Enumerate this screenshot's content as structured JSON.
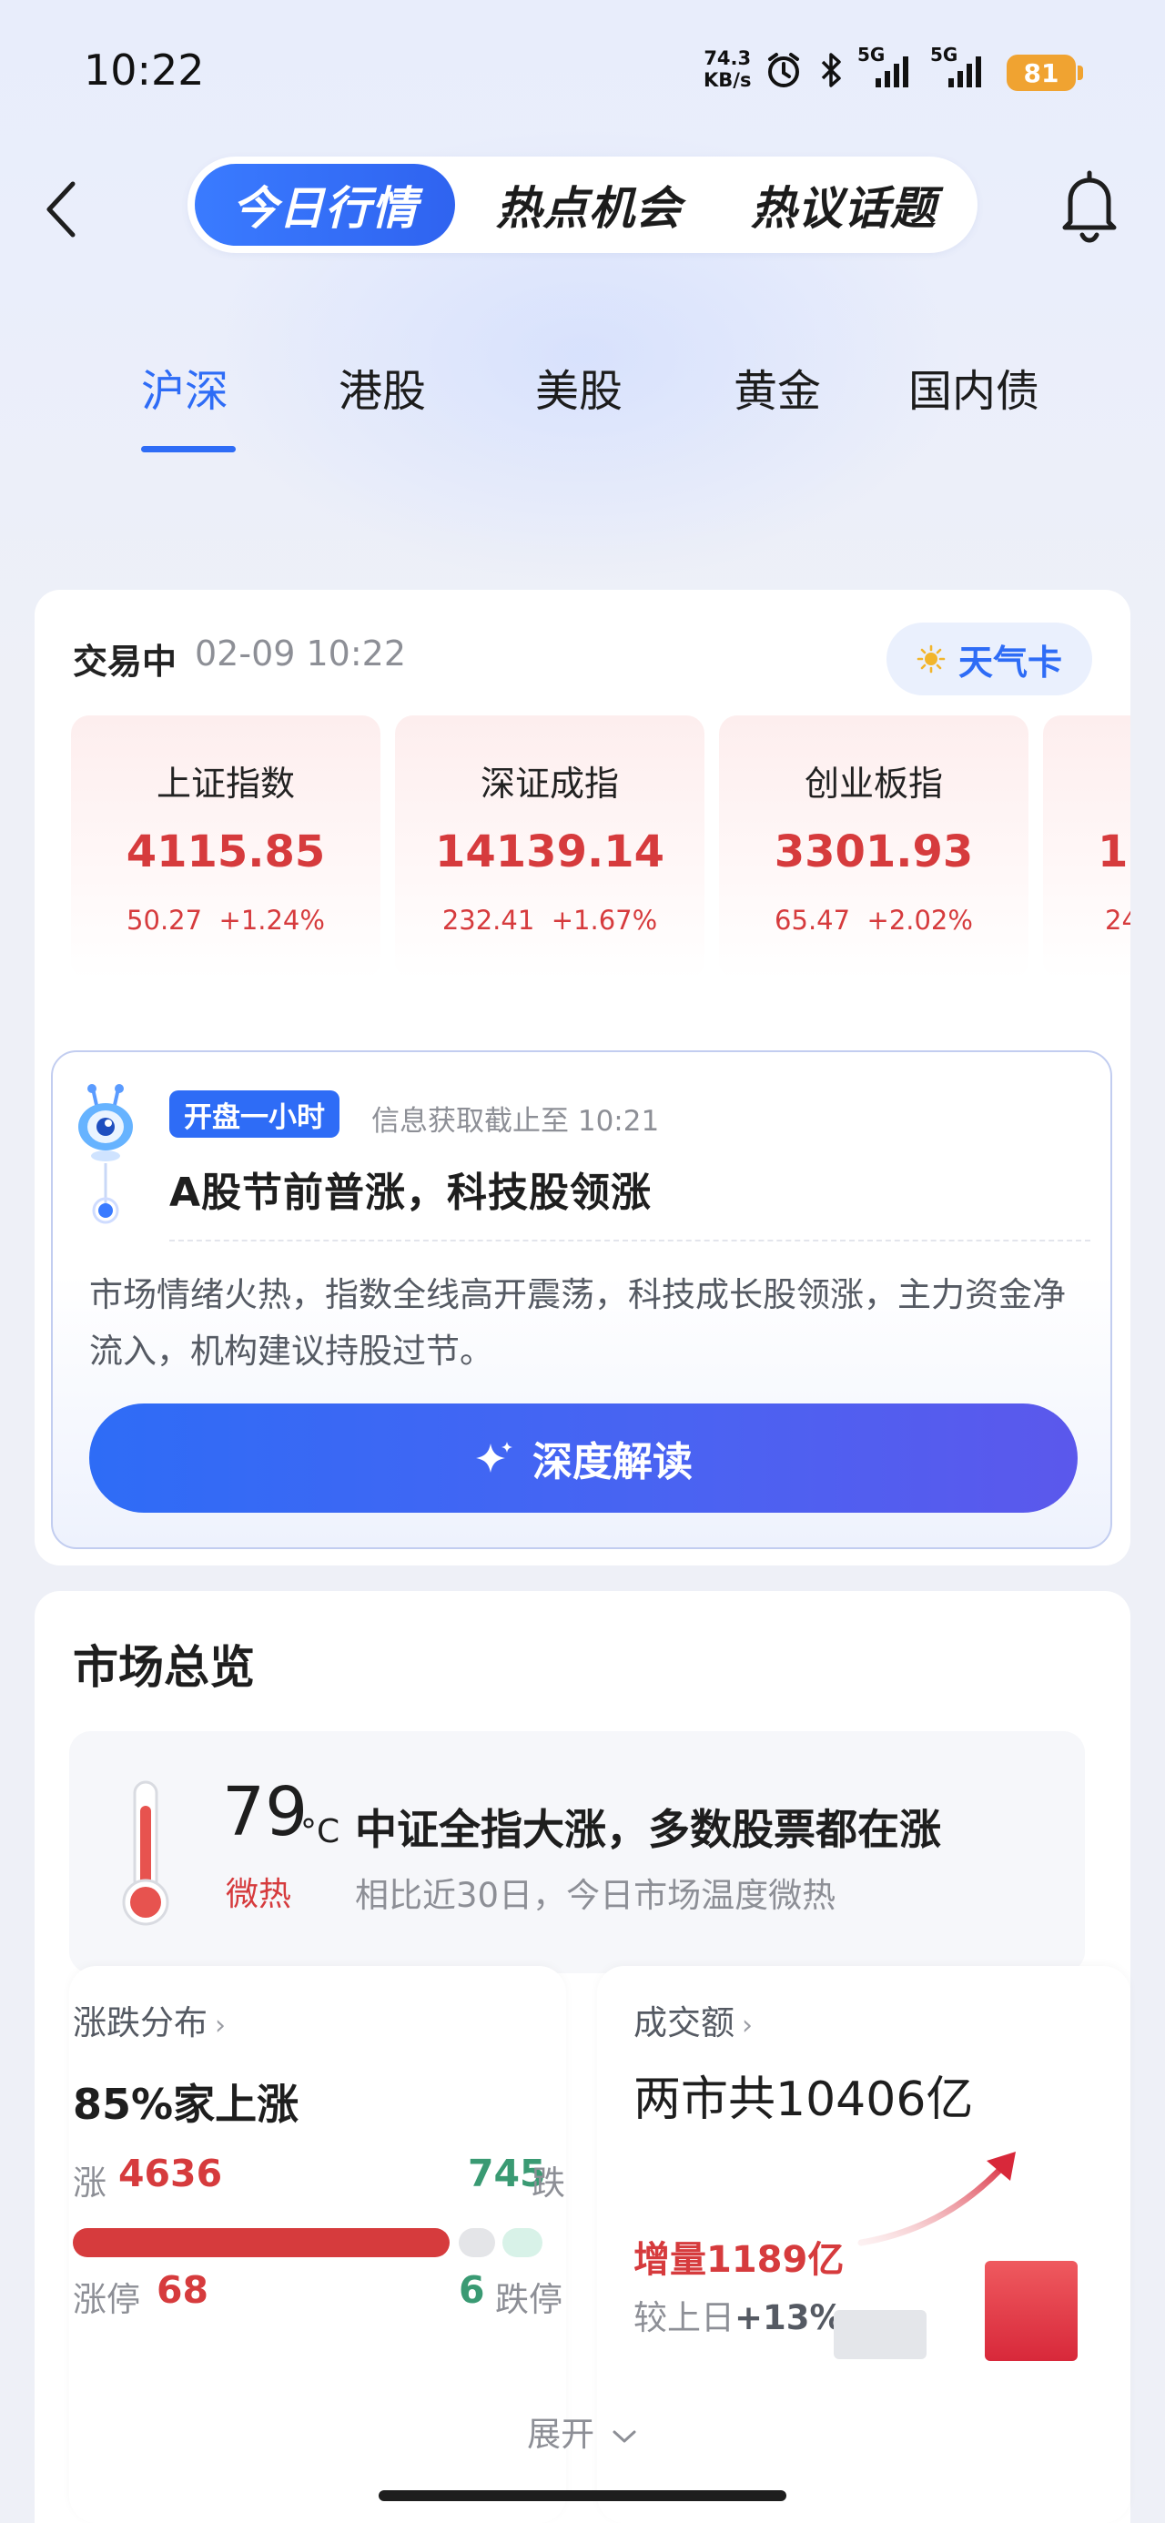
{
  "status_bar": {
    "time": "10:22",
    "net_speed_value": "74.3",
    "net_speed_unit": "KB/s",
    "signal1_label": "5G",
    "signal2_label": "5G",
    "battery": "81",
    "icons": [
      "alarm-icon",
      "bluetooth-icon",
      "signal-icon",
      "signal-icon",
      "battery-icon"
    ]
  },
  "header": {
    "segments": [
      "今日行情",
      "热点机会",
      "热议话题"
    ],
    "active_segment": 0
  },
  "market_tabs": {
    "items": [
      "沪深",
      "港股",
      "美股",
      "黄金",
      "国内债"
    ],
    "active": 0
  },
  "market_card": {
    "status": "交易中",
    "timestamp": "02-09 10:22",
    "weather_button": "天气卡",
    "indices": [
      {
        "name": "上证指数",
        "value": "4115.85",
        "change": "50.27",
        "pct": "+1.24%"
      },
      {
        "name": "深证成指",
        "value": "14139.14",
        "change": "232.41",
        "pct": "+1.67%"
      },
      {
        "name": "创业板指",
        "value": "3301.93",
        "change": "65.47",
        "pct": "+2.02%"
      },
      {
        "name": "",
        "value": "1",
        "change": "24",
        "pct": ""
      }
    ],
    "brief": {
      "badge": "开盘一小时",
      "meta": "信息获取截止至 10:21",
      "title": "A股节前普涨，科技股领涨",
      "body": "市场情绪火热，指数全线高开震荡，科技成长股领涨，主力资金净流入，机构建议持股过节。",
      "button": "深度解读"
    }
  },
  "overview": {
    "title": "市场总览",
    "temperature": {
      "value": "79",
      "unit": "°C",
      "level": "微热",
      "headline": "中证全指大涨，多数股票都在涨",
      "sub": "相比近30日，今日市场温度微热"
    },
    "distribution": {
      "label": "涨跌分布",
      "up_pct": "85%家上涨",
      "up_label": "涨",
      "up_count": "4636",
      "down_count": "745",
      "down_label": "跌",
      "limit_up_label": "涨停",
      "limit_up_count": "68",
      "limit_down_count": "6",
      "limit_down_label": "跌停"
    },
    "volume": {
      "label": "成交额",
      "headline": "两市共10406亿",
      "increase": "增量1189亿",
      "compare_label": "较上日",
      "compare_value": "+13%"
    },
    "expand": "展开"
  },
  "colors": {
    "accent": "#2e6cf6",
    "up": "#d63b3d",
    "down": "#3a9a73",
    "battery": "#f0a331"
  }
}
